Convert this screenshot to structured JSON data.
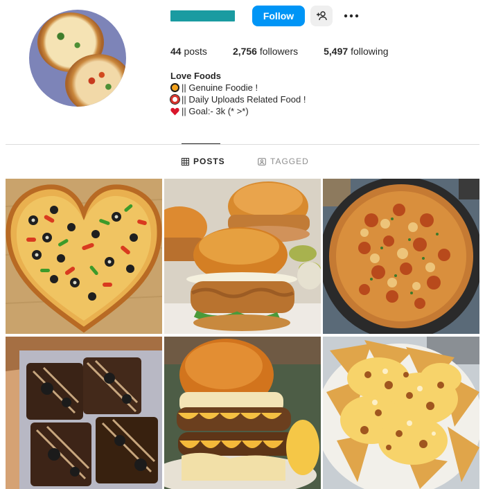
{
  "header": {
    "username_bar_color": "#1a9ba1",
    "follow_label": "Follow",
    "suggest_icon": "person-plus-icon",
    "more_icon": "more-options-icon"
  },
  "stats": {
    "posts": {
      "count": "44",
      "label": "posts"
    },
    "followers": {
      "count": "2,756",
      "label": "followers"
    },
    "following": {
      "count": "5,497",
      "label": "following"
    }
  },
  "bio": {
    "name": "Love Foods",
    "lines": [
      {
        "emoji": "orange-circle-emoji",
        "text": "|| Genuine Foodie !"
      },
      {
        "emoji": "red-ring-emoji",
        "text": "|| Daily Uploads Related Food !"
      },
      {
        "emoji": "red-heart-emoji",
        "text": "|| Goal:- 3k (* >*)"
      }
    ]
  },
  "tabs": [
    {
      "label": "POSTS",
      "icon": "grid-icon",
      "active": true
    },
    {
      "label": "TAGGED",
      "icon": "tagged-icon",
      "active": false
    }
  ],
  "posts": [
    {
      "subject": "heart-shaped-pizza"
    },
    {
      "subject": "fried-chicken-sandwiches"
    },
    {
      "subject": "pepperoni-pizza"
    },
    {
      "subject": "brownies-in-box"
    },
    {
      "subject": "loaded-cheese-burger"
    },
    {
      "subject": "cheesy-nachos"
    }
  ],
  "colors": {
    "accent": "#0095f6",
    "text": "#262626",
    "muted": "#8e8e8e",
    "divider": "#dbdbdb"
  }
}
